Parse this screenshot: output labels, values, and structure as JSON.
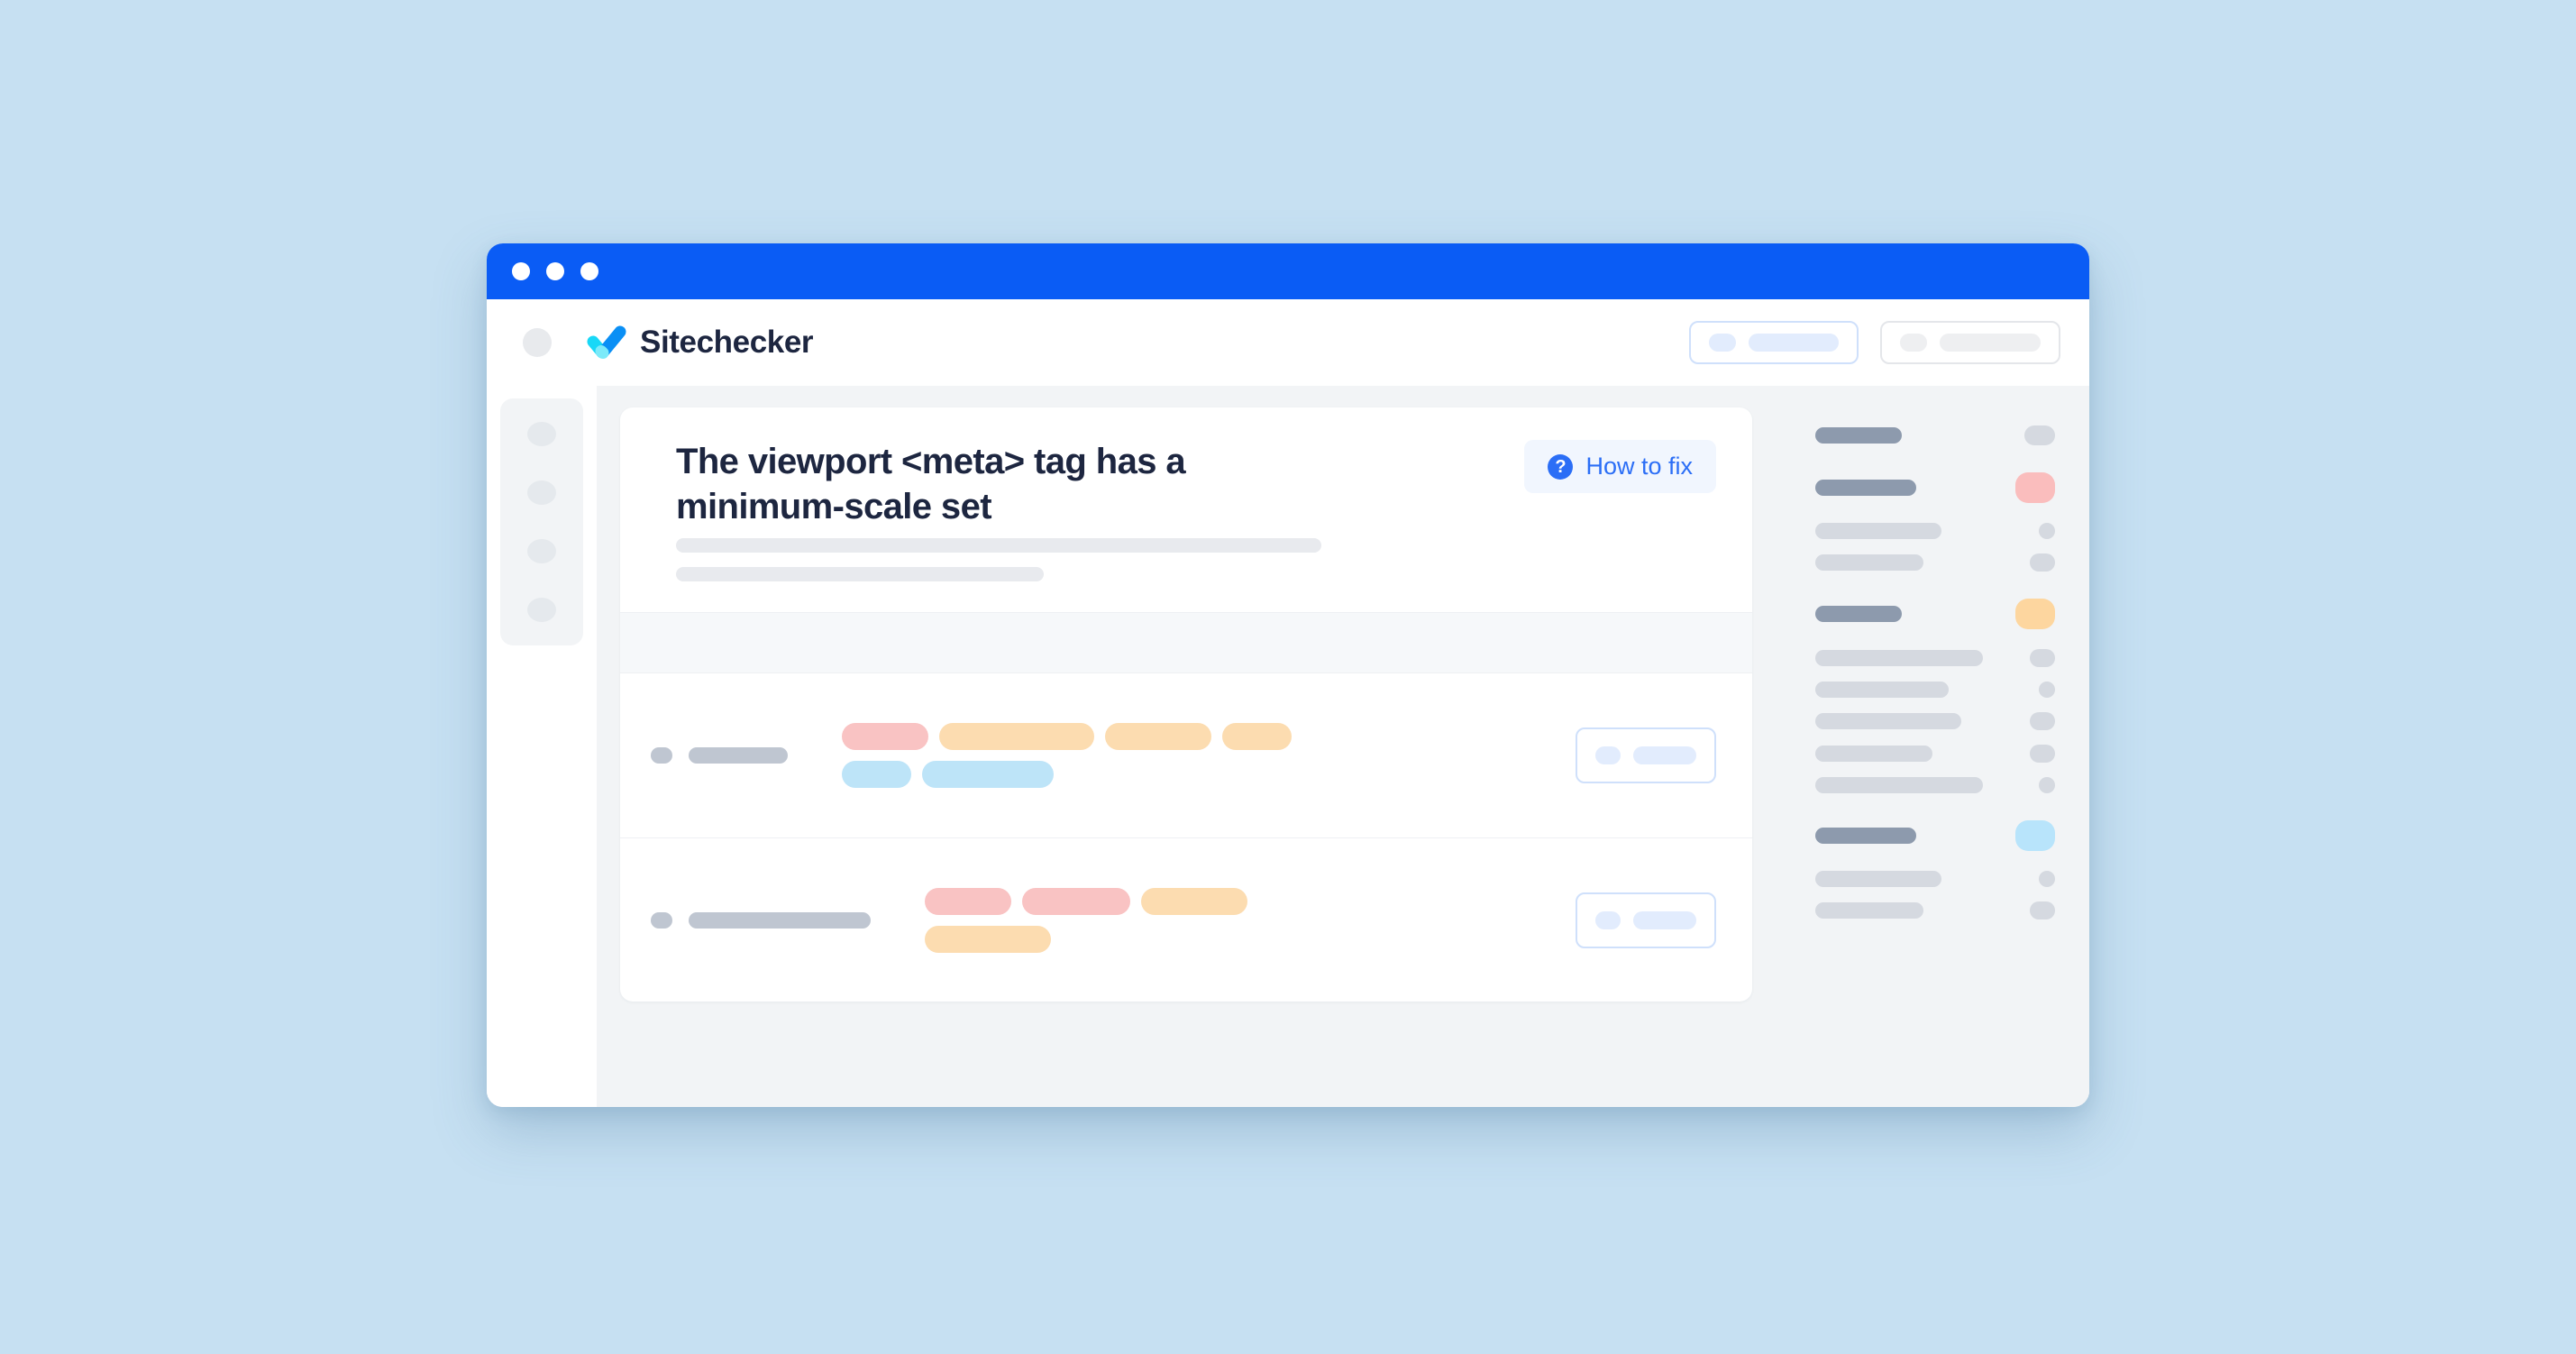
{
  "window": {
    "titlebar_dots": [
      "dot-1",
      "dot-2",
      "dot-3"
    ],
    "titlebar_color": "#0a5cf5"
  },
  "header": {
    "brand_name": "Sitechecker",
    "logo_icon": "sitechecker-check-logo",
    "menu_icon": "menu-placeholder-icon",
    "actions": [
      {
        "name": "primary-header-button",
        "style": "primary",
        "icon": "dot-placeholder",
        "label": ""
      },
      {
        "name": "secondary-header-button",
        "style": "secondary",
        "icon": "dot-placeholder",
        "label": ""
      }
    ]
  },
  "left_rail": {
    "items": [
      {
        "icon": "nav-circle-icon-1"
      },
      {
        "icon": "nav-circle-icon-2"
      },
      {
        "icon": "nav-circle-icon-3"
      },
      {
        "icon": "nav-circle-icon-4"
      }
    ]
  },
  "issue_card": {
    "title": "The viewport <meta> tag has a minimum-scale set",
    "subtitle_placeholder_widths": [
      716,
      408
    ],
    "how_to_fix": {
      "label": "How to fix",
      "icon": "question-mark-icon",
      "icon_glyph": "?",
      "accent_color": "#2b6ef6",
      "background_color": "#f1f6fe"
    },
    "table_header_band": true,
    "rows": [
      {
        "name": "issue-row-1",
        "label_bar_width": 110,
        "tags": [
          {
            "color": "pink",
            "width": 96
          },
          {
            "color": "orange",
            "width": 172
          },
          {
            "color": "orange",
            "width": 118
          },
          {
            "color": "orange",
            "width": 77
          },
          {
            "color": "blue",
            "width": 77
          },
          {
            "color": "blue",
            "width": 146
          }
        ],
        "action": {
          "name": "row-action-button",
          "icon": "dot-placeholder",
          "label": ""
        }
      },
      {
        "name": "issue-row-2",
        "label_bar_width": 202,
        "tags": [
          {
            "color": "pink",
            "width": 96
          },
          {
            "color": "pink",
            "width": 120
          },
          {
            "color": "orange",
            "width": 118
          },
          {
            "color": "orange",
            "width": 140
          }
        ],
        "action": {
          "name": "row-action-button",
          "icon": "dot-placeholder",
          "label": ""
        }
      }
    ]
  },
  "right_panel": {
    "groups": [
      {
        "lines": [
          {
            "weight": "strong",
            "width": 96,
            "badge": {
              "color": "gray",
              "width": 34,
              "height": 22
            }
          }
        ]
      },
      {
        "lines": [
          {
            "weight": "strong",
            "width": 112,
            "badge": {
              "color": "pink",
              "width": 44,
              "height": 34
            }
          },
          {
            "weight": "weak",
            "width": 140,
            "badge": {
              "color": "gray",
              "width": 18,
              "height": 18
            }
          },
          {
            "weight": "weak",
            "width": 120,
            "badge": {
              "color": "gray",
              "width": 28,
              "height": 20
            }
          }
        ]
      },
      {
        "lines": [
          {
            "weight": "strong",
            "width": 96,
            "badge": {
              "color": "orange",
              "width": 44,
              "height": 34
            }
          },
          {
            "weight": "weak",
            "width": 186,
            "badge": {
              "color": "gray",
              "width": 28,
              "height": 20
            }
          },
          {
            "weight": "weak",
            "width": 148,
            "badge": {
              "color": "gray",
              "width": 18,
              "height": 18
            }
          },
          {
            "weight": "weak",
            "width": 162,
            "badge": {
              "color": "gray",
              "width": 28,
              "height": 20
            }
          },
          {
            "weight": "weak",
            "width": 130,
            "badge": {
              "color": "gray",
              "width": 28,
              "height": 20
            }
          },
          {
            "weight": "weak",
            "width": 186,
            "badge": {
              "color": "gray",
              "width": 18,
              "height": 18
            }
          }
        ]
      },
      {
        "lines": [
          {
            "weight": "strong",
            "width": 112,
            "badge": {
              "color": "blue",
              "width": 44,
              "height": 34
            }
          },
          {
            "weight": "weak",
            "width": 140,
            "badge": {
              "color": "gray",
              "width": 18,
              "height": 18
            }
          },
          {
            "weight": "weak",
            "width": 120,
            "badge": {
              "color": "gray",
              "width": 28,
              "height": 20
            }
          }
        ]
      }
    ]
  },
  "colors": {
    "page_background": "#c6e0f2",
    "titlebar_blue": "#0a5cf5",
    "brand_dark": "#1d2640",
    "accent_blue": "#2b6ef6",
    "tag_pink": "#f9c3c3",
    "tag_orange": "#fcdcb0",
    "tag_blue": "#bde4f8",
    "panel_gray": "#f2f4f6"
  }
}
